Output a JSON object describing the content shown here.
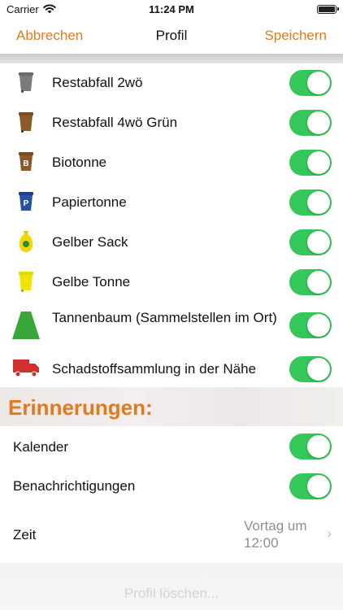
{
  "status": {
    "carrier": "Carrier",
    "time": "11:24 PM"
  },
  "nav": {
    "cancel": "Abbrechen",
    "title": "Profil",
    "save": "Speichern"
  },
  "items": [
    {
      "label": "Restabfall 2wö",
      "icon": "gray-bin-icon",
      "color": "#6b6b6b",
      "enabled": true
    },
    {
      "label": "Restabfall 4wö Grün",
      "icon": "brown-bin-icon",
      "color": "#8a5a2b",
      "enabled": true
    },
    {
      "label": "Biotonne",
      "icon": "bio-bin-icon",
      "color": "#8a5a2b",
      "badge": "B",
      "enabled": true
    },
    {
      "label": "Papiertonne",
      "icon": "paper-bin-icon",
      "color": "#2b4fa3",
      "badge": "P",
      "enabled": true
    },
    {
      "label": "Gelber Sack",
      "icon": "yellow-sack-icon",
      "color": "#f2d600",
      "enabled": true
    },
    {
      "label": "Gelbe Tonne",
      "icon": "yellow-bin-icon",
      "color": "#f2e400",
      "enabled": true
    },
    {
      "label": "Tannenbaum (Sammelstellen im Ort)",
      "icon": "tree-icon",
      "color": "#3aa63a",
      "enabled": true
    },
    {
      "label": "Schadstoffsammlung in der Nähe",
      "icon": "truck-icon",
      "color": "#d32f2f",
      "enabled": true
    }
  ],
  "reminders": {
    "title": "Erinnerungen:",
    "calendar": {
      "label": "Kalender",
      "enabled": true
    },
    "notifications": {
      "label": "Benachrichtigungen",
      "enabled": true
    },
    "time": {
      "label": "Zeit",
      "value": "Vortag um 12:00"
    }
  },
  "footer": {
    "delete": "Profil löschen..."
  },
  "colors": {
    "accent": "#e07a1f",
    "toggle_on": "#34c759"
  }
}
